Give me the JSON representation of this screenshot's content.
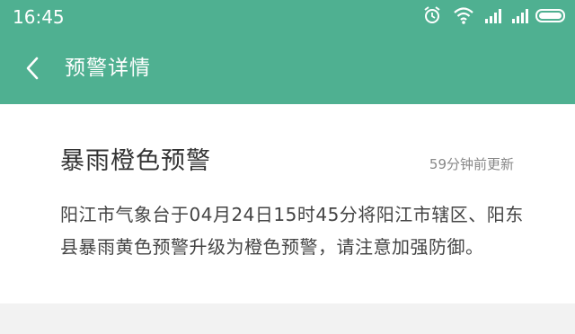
{
  "status_bar": {
    "time": "16:45",
    "icons": [
      "alarm-icon",
      "wifi-icon",
      "signal-icon",
      "signal-icon-2",
      "battery-icon"
    ]
  },
  "header": {
    "back_icon": "chevron-left-icon",
    "title": "预警详情"
  },
  "alert": {
    "title": "暴雨橙色预警",
    "updated": "59分钟前更新",
    "body": "阳江市气象台于04月24日15时45分将阳江市辖区、阳东县暴雨黄色预警升级为橙色预警，请注意加强防御。"
  },
  "colors": {
    "accent": "#4fb091",
    "card_bg": "#ffffff",
    "page_bg": "#f2f2f2",
    "title_text": "#333333",
    "body_text": "#444444",
    "meta_text": "#888888"
  }
}
